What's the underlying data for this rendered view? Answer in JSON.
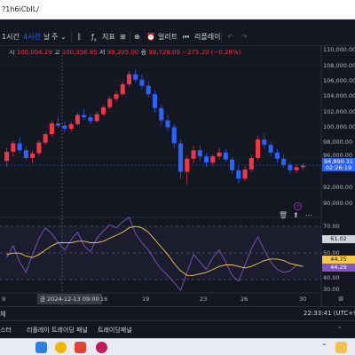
{
  "address_bar": {
    "url": "?1h6iCbIL/"
  },
  "toolbar": {
    "interval_1": "1시간",
    "interval_4": "4시간",
    "interval_day": "날",
    "interval_week": "주",
    "indicators_label": "지표",
    "alert_label": "얼러트",
    "replay_label": "리플레이"
  },
  "ohlc": {
    "open_key": "시",
    "open_value": "100,004.29",
    "high_key": "고",
    "high_value": "100,356.85",
    "low_key": "저",
    "low_value": "99,205.00",
    "close_key": "종",
    "close_value": "99,729.09",
    "change_value": "−275.20 (−0.28%)"
  },
  "price_axis": {
    "labels": [
      "110,000.00",
      "108,000.00",
      "106,000.00",
      "104,000.00",
      "102,000.00",
      "100,000.00",
      "98,000.00",
      "96,000.00",
      "92,000.00",
      "90,000.00"
    ],
    "current_price": "94,890.31",
    "countdown": "02:26:19"
  },
  "rsi_axis": {
    "labels": [
      "70.00",
      "50.00",
      "40.00",
      "30.00"
    ],
    "rsi_value": "61.02",
    "rsi_value_2": "44.75",
    "rsi_value_3": "44.29"
  },
  "x_axis": {
    "labels": [
      "9",
      "16",
      "19",
      "23",
      "26",
      "30"
    ],
    "crosshair_date": "금 2024-12-13",
    "crosshair_time": "09:00"
  },
  "status_bar": {
    "left_text": "체",
    "time": "22:33:41 (UTC+9)"
  },
  "panel_tabs": [
    "스터",
    "리플레이 트레이딩 패널",
    "트레이딩패널"
  ],
  "colors": {
    "up": "#f23645",
    "down": "#2962ff",
    "rsi_line": "#7e57c2",
    "rsi_ma": "#f7c948",
    "background": "#131722"
  },
  "icons": [
    "undo-icon",
    "redo-icon",
    "trash-icon",
    "cursor-icon",
    "settings-icon"
  ],
  "chart_data": [
    {
      "type": "candlestick",
      "series": [
        {
          "name": "",
          "ohlc": [
            [
              95500,
              97200,
              94800,
              96700
            ],
            [
              96700,
              98100,
              96100,
              97800
            ],
            [
              97800,
              98600,
              96500,
              96900
            ],
            [
              96900,
              97400,
              95600,
              95900
            ],
            [
              95900,
              96800,
              95200,
              96500
            ],
            [
              96500,
              98200,
              96200,
              97900
            ],
            [
              97900,
              99300,
              97600,
              99000
            ],
            [
              99000,
              100800,
              98700,
              100400
            ],
            [
              100400,
              101300,
              99800,
              100100
            ],
            [
              100100,
              100700,
              99200,
              99700
            ],
            [
              99700,
              100600,
              99300,
              100300
            ],
            [
              100300,
              101800,
              100100,
              101500
            ],
            [
              101500,
              102300,
              100900,
              101200
            ],
            [
              101200,
              101600,
              100300,
              100700
            ],
            [
              100700,
              101900,
              100500,
              101600
            ],
            [
              101600,
              102800,
              101400,
              102500
            ],
            [
              102500,
              103900,
              102200,
              103600
            ],
            [
              103600,
              104600,
              103200,
              104200
            ],
            [
              104200,
              105900,
              104000,
              105500
            ],
            [
              105500,
              107200,
              105200,
              106800
            ],
            [
              106800,
              107400,
              105700,
              106100
            ],
            [
              106100,
              106800,
              104900,
              105300
            ],
            [
              105300,
              105900,
              103800,
              104200
            ],
            [
              104200,
              104700,
              101800,
              102400
            ],
            [
              102400,
              102900,
              100200,
              100800
            ],
            [
              100800,
              101500,
              99400,
              99900
            ],
            [
              99900,
              100400,
              97200,
              97800
            ],
            [
              97800,
              98300,
              93200,
              94100
            ],
            [
              94100,
              96200,
              92400,
              95800
            ],
            [
              95800,
              97500,
              95200,
              96900
            ],
            [
              96900,
              97600,
              95500,
              96100
            ],
            [
              96100,
              96600,
              94700,
              95300
            ],
            [
              95300,
              96400,
              94900,
              96100
            ],
            [
              96100,
              97200,
              95700,
              96600
            ],
            [
              96600,
              97100,
              95400,
              95700
            ],
            [
              95700,
              96000,
              93800,
              94300
            ],
            [
              94300,
              94900,
              92600,
              93200
            ],
            [
              93200,
              94800,
              92900,
              94400
            ],
            [
              94400,
              96300,
              94100,
              95900
            ],
            [
              95900,
              98800,
              95600,
              98300
            ],
            [
              98300,
              99100,
              97100,
              97600
            ],
            [
              97600,
              98000,
              96200,
              96600
            ],
            [
              96600,
              97100,
              95300,
              95800
            ],
            [
              95800,
              96400,
              94600,
              95000
            ],
            [
              95000,
              95400,
              93800,
              94300
            ],
            [
              94300,
              95100,
              93900,
              94700
            ],
            [
              94700,
              95200,
              94300,
              94900
            ]
          ]
        }
      ],
      "ylim": [
        90000,
        110000
      ]
    },
    {
      "type": "line",
      "series": [
        {
          "values": [
            50,
            58,
            47,
            40,
            52,
            63,
            70,
            66,
            60,
            55,
            62,
            67,
            58,
            54,
            63,
            68,
            72,
            70,
            74,
            77,
            66,
            60,
            55,
            48,
            42,
            38,
            33,
            28,
            40,
            52,
            47,
            42,
            50,
            55,
            47,
            38,
            34,
            45,
            56,
            64,
            55,
            47,
            42,
            40,
            41,
            45,
            44
          ]
        },
        {
          "values": [
            52,
            53,
            53,
            51,
            50,
            52,
            55,
            58,
            60,
            60,
            60,
            61,
            61,
            60,
            60,
            61,
            63,
            65,
            67,
            70,
            71,
            70,
            67,
            62,
            57,
            52,
            46,
            41,
            38,
            38,
            39,
            40,
            42,
            44,
            45,
            45,
            44,
            43,
            44,
            46,
            48,
            49,
            49,
            48,
            46,
            45,
            44
          ]
        }
      ],
      "ylim": [
        25,
        80
      ]
    }
  ]
}
